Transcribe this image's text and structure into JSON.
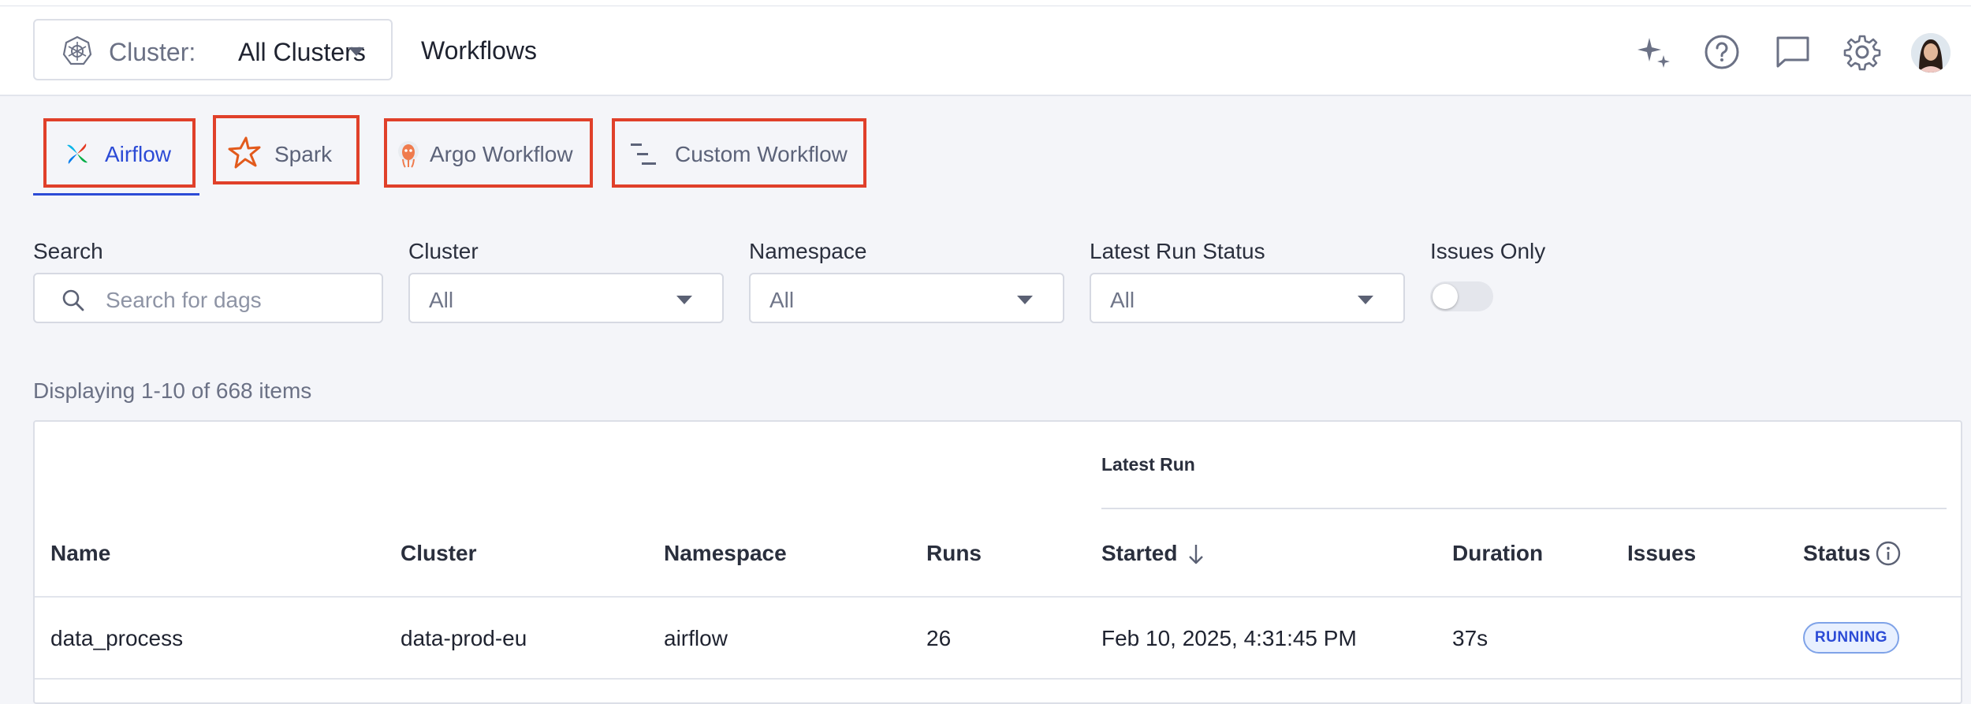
{
  "header": {
    "cluster_label": "Cluster:",
    "cluster_value": "All Clusters",
    "page_title": "Workflows"
  },
  "tabs": [
    {
      "label": "Airflow",
      "active": true
    },
    {
      "label": "Spark",
      "active": false
    },
    {
      "label": "Argo Workflow",
      "active": false
    },
    {
      "label": "Custom Workflow",
      "active": false
    }
  ],
  "filters": {
    "search": {
      "label": "Search",
      "placeholder": "Search for dags"
    },
    "cluster": {
      "label": "Cluster",
      "value": "All"
    },
    "namespace": {
      "label": "Namespace",
      "value": "All"
    },
    "status": {
      "label": "Latest Run Status",
      "value": "All"
    },
    "issues_only": {
      "label": "Issues Only",
      "on": false
    }
  },
  "summary": "Displaying 1-10 of 668 items",
  "table": {
    "group_header": "Latest Run",
    "columns": [
      "Name",
      "Cluster",
      "Namespace",
      "Runs",
      "Started",
      "Duration",
      "Issues",
      "Status"
    ],
    "rows": [
      {
        "name": "data_process",
        "cluster": "data-prod-eu",
        "namespace": "airflow",
        "runs": "26",
        "started": "Feb 10, 2025, 4:31:45 PM",
        "duration": "37s",
        "issues": "",
        "status": "RUNNING"
      }
    ]
  },
  "colors": {
    "accent": "#2c4bd6",
    "highlight_box": "#e0402a",
    "badge_bg": "#e8f0ff"
  }
}
